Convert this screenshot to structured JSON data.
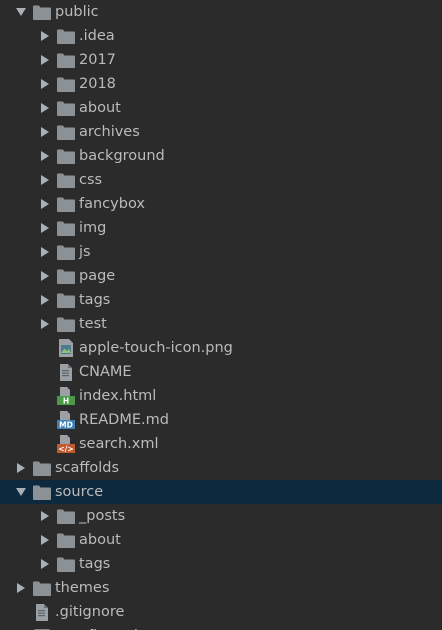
{
  "tree": [
    {
      "label": "public",
      "type": "folder",
      "expanded": true,
      "depth": 0
    },
    {
      "label": ".idea",
      "type": "folder",
      "expanded": false,
      "depth": 1
    },
    {
      "label": "2017",
      "type": "folder",
      "expanded": false,
      "depth": 1
    },
    {
      "label": "2018",
      "type": "folder",
      "expanded": false,
      "depth": 1
    },
    {
      "label": "about",
      "type": "folder",
      "expanded": false,
      "depth": 1
    },
    {
      "label": "archives",
      "type": "folder",
      "expanded": false,
      "depth": 1
    },
    {
      "label": "background",
      "type": "folder",
      "expanded": false,
      "depth": 1
    },
    {
      "label": "css",
      "type": "folder",
      "expanded": false,
      "depth": 1
    },
    {
      "label": "fancybox",
      "type": "folder",
      "expanded": false,
      "depth": 1
    },
    {
      "label": "img",
      "type": "folder",
      "expanded": false,
      "depth": 1
    },
    {
      "label": "js",
      "type": "folder",
      "expanded": false,
      "depth": 1
    },
    {
      "label": "page",
      "type": "folder",
      "expanded": false,
      "depth": 1
    },
    {
      "label": "tags",
      "type": "folder",
      "expanded": false,
      "depth": 1
    },
    {
      "label": "test",
      "type": "folder",
      "expanded": false,
      "depth": 1
    },
    {
      "label": "apple-touch-icon.png",
      "type": "file",
      "icon": "image-file-icon",
      "depth": 1
    },
    {
      "label": "CNAME",
      "type": "file",
      "icon": "text-file-icon",
      "depth": 1
    },
    {
      "label": "index.html",
      "type": "file",
      "icon": "html-file-icon",
      "depth": 1
    },
    {
      "label": "README.md",
      "type": "file",
      "icon": "markdown-file-icon",
      "depth": 1
    },
    {
      "label": "search.xml",
      "type": "file",
      "icon": "xml-file-icon",
      "depth": 1
    },
    {
      "label": "scaffolds",
      "type": "folder",
      "expanded": false,
      "depth": 0
    },
    {
      "label": "source",
      "type": "folder",
      "expanded": true,
      "depth": 0,
      "selected": true
    },
    {
      "label": "_posts",
      "type": "folder",
      "expanded": false,
      "depth": 1
    },
    {
      "label": "about",
      "type": "folder",
      "expanded": false,
      "depth": 1
    },
    {
      "label": "tags",
      "type": "folder",
      "expanded": false,
      "depth": 1
    },
    {
      "label": "themes",
      "type": "folder",
      "expanded": false,
      "depth": 0
    },
    {
      "label": ".gitignore",
      "type": "file",
      "icon": "text-file-icon",
      "depth": 0
    },
    {
      "label": "_config.yml",
      "type": "file",
      "icon": "config-file-icon",
      "depth": 0
    }
  ],
  "colors": {
    "background": "#2b2b2b",
    "selected_row": "#0d293e",
    "text": "#bbbbbb",
    "folder": "#8c9196",
    "arrow": "#a9b0b6",
    "html_badge": "#4a9b48",
    "md_badge": "#3f7fb3",
    "xml_badge": "#c25a2d"
  }
}
